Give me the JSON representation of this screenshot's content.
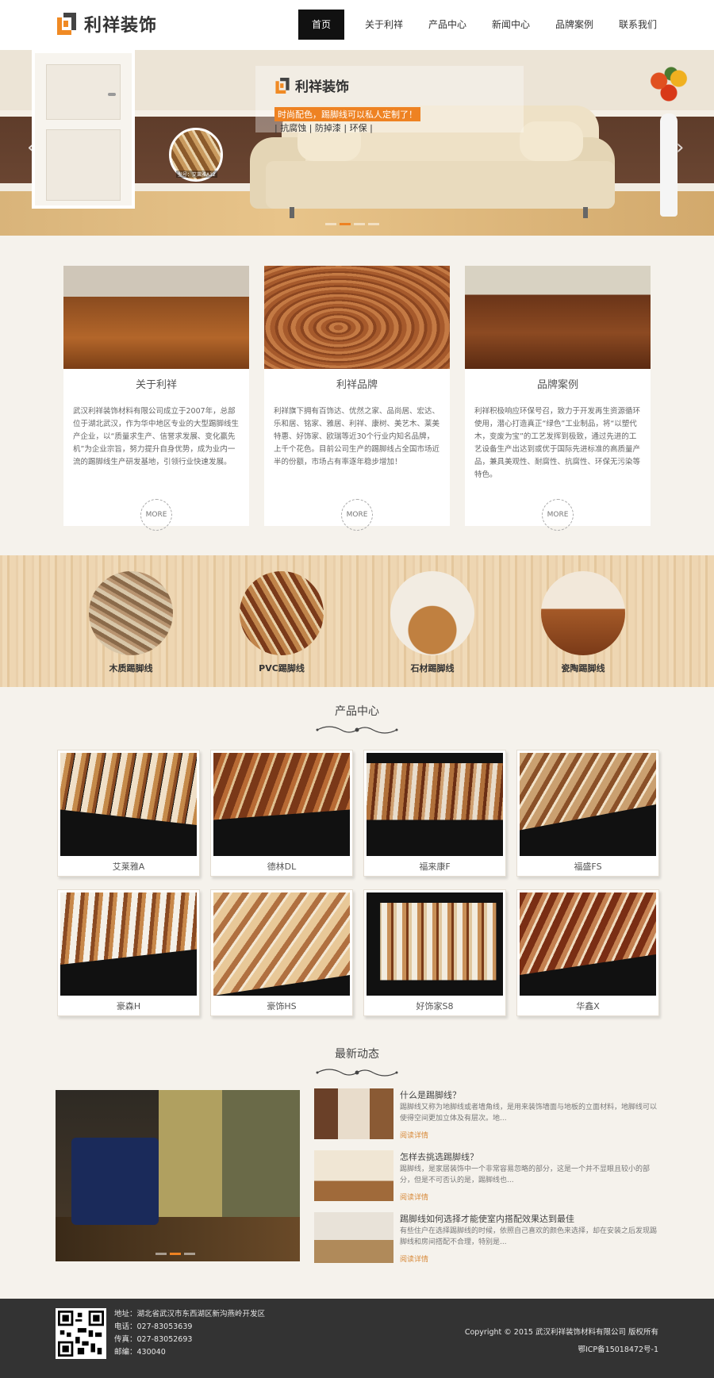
{
  "brand": {
    "name": "利祥装饰"
  },
  "nav": {
    "items": [
      "首页",
      "关于利祥",
      "产品中心",
      "新闻中心",
      "品牌案例",
      "联系我们"
    ],
    "active_index": 0
  },
  "banner": {
    "brand": "利祥装饰",
    "tagline": "时尚配色，踢脚线可以私人定制了！",
    "features": "| 抗腐蚀 | 防掉漆 | 环保 |",
    "sample_caption": "型号：艾莱雅A12",
    "arrow_left": "‹",
    "arrow_right": "›",
    "active_dot": 1
  },
  "intro": {
    "cards": [
      {
        "title": "关于利祥",
        "text": "武汉利祥装饰材料有限公司成立于2007年，总部位于湖北武汉，作为华中地区专业的大型踢脚线生产企业，以“质量求生产、信誉求发展、变化赢先机”为企业宗旨，努力提升自身优势，成为业内一流的踢脚线生产研发基地，引领行业快速发展。",
        "more": "MORE"
      },
      {
        "title": "利祥品牌",
        "text": "利祥旗下拥有百饰达、优然之家、品尚居、宏达、乐和居、铭家、雅居、利祥、康树、美艺木、莱美特惠、好饰家、欧瑞等近30个行业内知名品牌，上千个花色。目前公司生产的踢脚线占全国市场近半的份额，市场占有率逐年稳步增加！",
        "more": "MORE"
      },
      {
        "title": "品牌案例",
        "text": "利祥积极响应环保号召，致力于开发再生资源循环使用，潜心打造真正“绿色”工业制品，将“以塑代木，变废为宝”的工艺发挥到极致，通过先进的工艺设备生产出达到或优于国际先进标准的高质量产品，兼具美观性、耐腐性、抗腐性、环保无污染等特色。",
        "more": "MORE"
      }
    ]
  },
  "categories": [
    "木质踢脚线",
    "PVC踢脚线",
    "石材踢脚线",
    "瓷陶踢脚线"
  ],
  "products_section": {
    "title": "产品中心",
    "items": [
      "艾莱雅A",
      "德林DL",
      "福来康F",
      "福盛FS",
      "豪森H",
      "豪饰HS",
      "好饰家S8",
      "华鑫X"
    ]
  },
  "news_section": {
    "title": "最新动态",
    "items": [
      {
        "title": "什么是踢脚线？",
        "desc": "踢脚线又称为地脚线或者墙角线，是用来装饰墙面与地板的立面材料，地脚线可以使得空间更加立体及有层次。地...",
        "link": "阅读详情"
      },
      {
        "title": "怎样去挑选踢脚线？",
        "desc": "踢脚线，是家居装饰中一个非常容易忽略的部分，这是一个并不显眼且较小的部分，但是不可否认的是，踢脚线也...",
        "link": "阅读详情"
      },
      {
        "title": "踢脚线如何选择才能使室内搭配效果达到最佳",
        "desc": "有些住户在选择踢脚线的时候，依照自己喜欢的颜色来选择，却在安装之后发现踢脚线和房间搭配不合理，特别是...",
        "link": "阅读详情"
      }
    ]
  },
  "footer": {
    "address": "地址：湖北省武汉市东西湖区新沟燕岭开发区",
    "phone": "电话：027-83053639",
    "fax": "传真：027-83052693",
    "postcode": "邮编：430040",
    "copyright": "Copyright © 2015 武汉利祥装饰材料有限公司 版权所有",
    "icp": "鄂ICP备15018472号-1"
  },
  "colors": {
    "accent": "#ee8222",
    "dark": "#111111",
    "footer": "#333333",
    "background": "#f5f2ec"
  }
}
